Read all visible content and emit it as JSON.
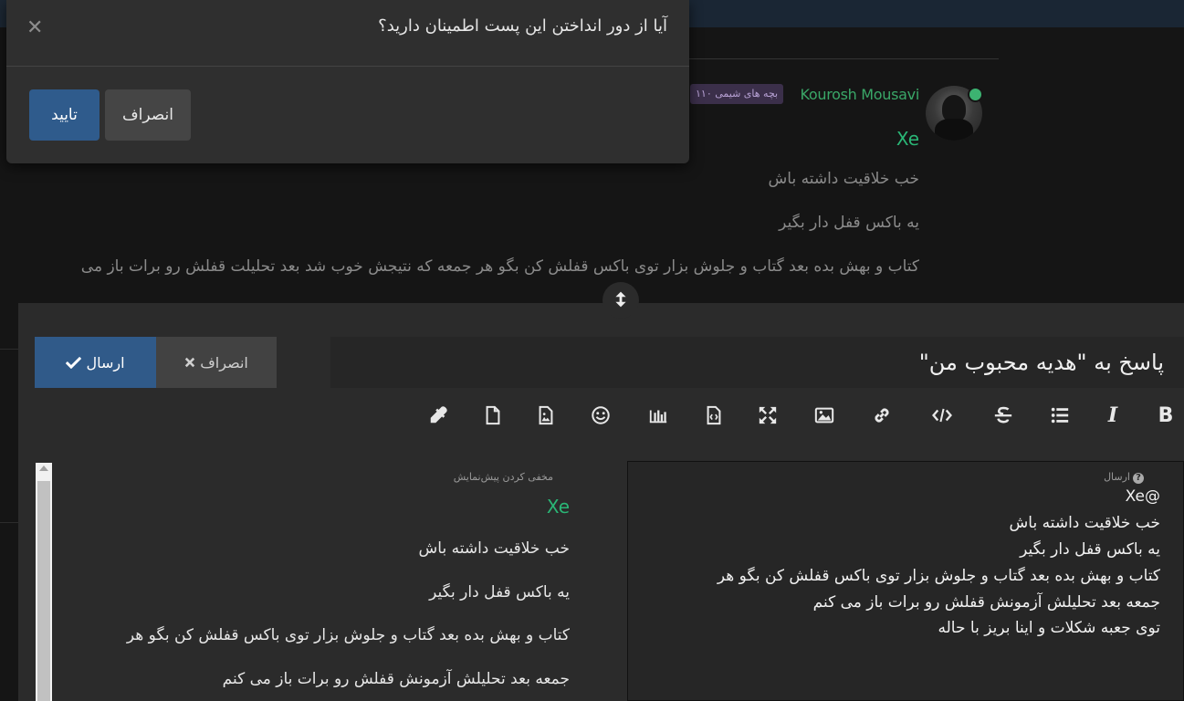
{
  "modal": {
    "title": "آیا از دور انداختن این پست اطمینان دارید؟",
    "close_glyph": "✕",
    "confirm_label": "تایید",
    "cancel_label": "انصراف"
  },
  "post": {
    "username": "Kourosh Mousavi",
    "group_badge": "بچه های شیمی ۱۱۰",
    "mention": "Xe",
    "lines": [
      "خب خلاقیت داشته باش",
      "یه باکس قفل دار بگیر",
      "کتاب و بهش بده بعد گتاب و جلوش بزار توی باکس قفلش کن بگو هر جمعه که نتیجش خوب شد بعد تحلیلت قفلش رو برات باز می"
    ]
  },
  "composer": {
    "submit_label": "ارسال",
    "discard_label": "انصراف",
    "title_value": "پاسخ به \"هدیه محبوب من\"",
    "toolbar": [
      {
        "name": "bold-icon",
        "label": "B"
      },
      {
        "name": "italic-icon",
        "label": "I"
      },
      {
        "name": "list-icon",
        "label": "list"
      },
      {
        "name": "strikethrough-icon",
        "label": "strike"
      },
      {
        "name": "code-icon",
        "label": "code"
      },
      {
        "name": "link-icon",
        "label": "link"
      },
      {
        "name": "image-icon",
        "label": "image"
      },
      {
        "name": "fullscreen-icon",
        "label": "zen"
      },
      {
        "name": "file-upload-icon",
        "label": "upload"
      },
      {
        "name": "chart-icon",
        "label": "poll"
      },
      {
        "name": "emoji-icon",
        "label": "emoji"
      },
      {
        "name": "image-file-icon",
        "label": "upload-image"
      },
      {
        "name": "file-icon",
        "label": "file"
      },
      {
        "name": "color-picker-icon",
        "label": "color"
      }
    ],
    "editor_help": "ارسال",
    "editor_lines": [
      "@Xe",
      "خب خلاقیت داشته باش",
      "یه باکس قفل دار بگیر",
      "کتاب و بهش بده بعد گتاب و جلوش بزار توی باکس قفلش کن بگو هر",
      "جمعه بعد تحلیلش آزمونش قفلش رو برات باز می کنم",
      "توی جعبه شکلات و اینا بریز با حاله"
    ],
    "preview_hide": "مخفی کردن پیش‌نمایش",
    "preview_mention": "Xe",
    "preview_lines": [
      "خب خلاقیت داشته باش",
      "یه باکس قفل دار بگیر",
      "کتاب و بهش بده بعد گتاب و جلوش بزار توی باکس قفلش کن بگو هر",
      "جمعه بعد تحلیلش آزمونش قفلش رو برات باز می کنم"
    ]
  }
}
